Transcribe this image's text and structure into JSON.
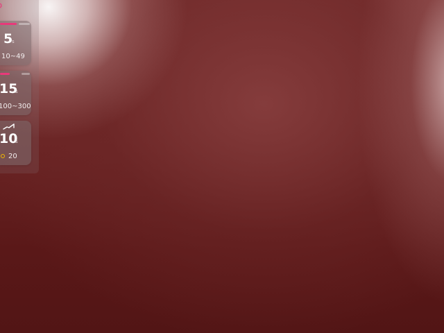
{
  "panel": {
    "top_icon": "⚙",
    "top_icon_name": "gear-icon",
    "accent_color": "#e8397a",
    "cards": [
      {
        "value": "5",
        "unit": "s",
        "range": "10~49",
        "progress": 0.55
      },
      {
        "value": "15",
        "unit": "s",
        "range": "100~300",
        "progress": 0.3
      },
      {
        "value": "10",
        "unit": "s",
        "count": "20",
        "icon": "trend-icon",
        "dot_color": "#f1b800"
      }
    ]
  }
}
